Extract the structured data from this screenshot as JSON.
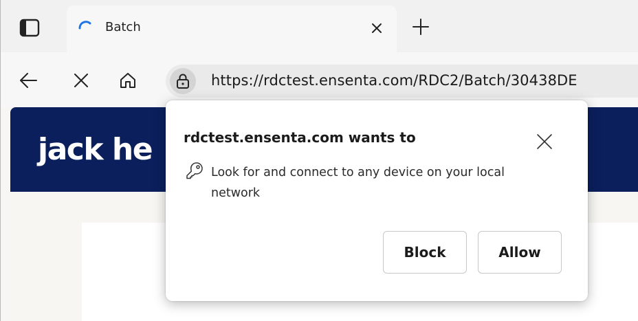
{
  "tab": {
    "title": "Batch",
    "status": "loading"
  },
  "toolbar": {
    "url": "https://rdctest.ensenta.com/RDC2/Batch/30438DE"
  },
  "page": {
    "brand": "jack he"
  },
  "permission_popup": {
    "title": "rdctest.ensenta.com wants to",
    "message": "Look for and connect to any device on your local network",
    "block_label": "Block",
    "allow_label": "Allow"
  },
  "colors": {
    "header_background": "#0a1f5c",
    "spinner": "#1a73e8",
    "brand_dot": "#3d8bff"
  },
  "icons": {
    "tab_actions": "tab-actions-icon",
    "spinner": "loading-spinner-icon",
    "tab_close": "close-icon",
    "new_tab": "plus-icon",
    "back": "back-arrow-icon",
    "stop": "stop-icon",
    "home": "home-icon",
    "site_info": "lock-icon",
    "popup_close": "close-icon",
    "permission": "key-icon"
  }
}
